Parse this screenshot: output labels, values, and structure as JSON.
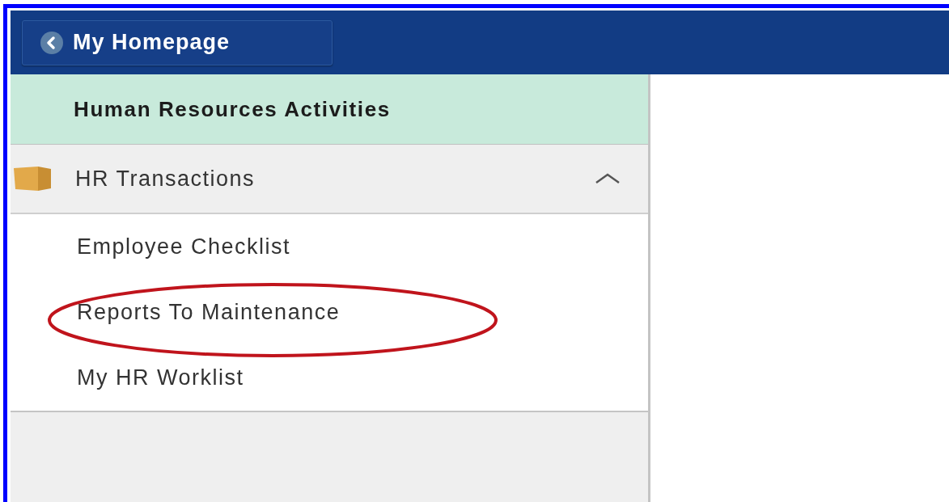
{
  "header": {
    "back_button": {
      "label": "My Homepage"
    }
  },
  "sidebar": {
    "title": "Human Resources Activities",
    "groups": [
      {
        "label": "HR Transactions",
        "expanded": true,
        "children": [
          {
            "label": "Employee Checklist",
            "highlighted": false
          },
          {
            "label": "Reports To Maintenance",
            "highlighted": true
          },
          {
            "label": "My HR Worklist",
            "highlighted": false
          }
        ]
      }
    ]
  }
}
